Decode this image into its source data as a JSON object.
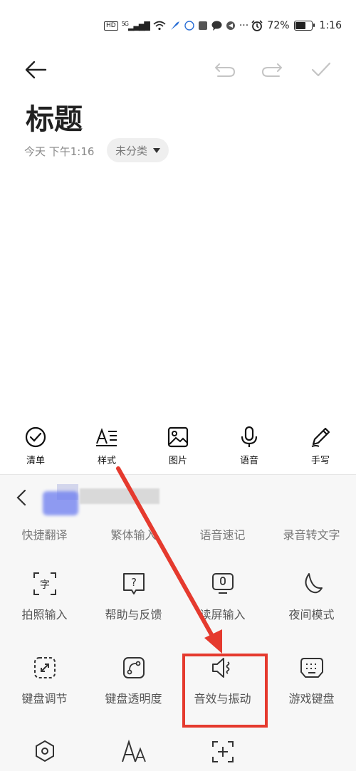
{
  "status_bar": {
    "hd": "HD",
    "signal": "5G",
    "battery_pct": "72%",
    "time": "1:16",
    "battery_level": 0.72,
    "icons": [
      "signal-icon",
      "wifi-icon",
      "app-icon",
      "chat-icon",
      "more-dots-icon",
      "alarm-icon",
      "battery-icon"
    ]
  },
  "note": {
    "title": "标题",
    "date": "今天  下午1:16",
    "category": "未分类"
  },
  "toolbar": {
    "items": [
      {
        "label": "清单",
        "icon": "checklist-icon"
      },
      {
        "label": "样式",
        "icon": "text-style-icon"
      },
      {
        "label": "图片",
        "icon": "image-icon"
      },
      {
        "label": "语音",
        "icon": "microphone-icon"
      },
      {
        "label": "手写",
        "icon": "pen-icon"
      }
    ]
  },
  "keyboard": {
    "top_row": [
      "快捷翻译",
      "繁体输入",
      "语音速记",
      "录音转文字"
    ],
    "row1": [
      {
        "label": "拍照输入",
        "icon": "camera-text-icon"
      },
      {
        "label": "帮助与反馈",
        "icon": "help-icon"
      },
      {
        "label": "读屏输入",
        "icon": "screen-input-icon"
      },
      {
        "label": "夜间模式",
        "icon": "moon-icon"
      }
    ],
    "row2": [
      {
        "label": "键盘调节",
        "icon": "resize-icon"
      },
      {
        "label": "键盘透明度",
        "icon": "transparency-icon"
      },
      {
        "label": "音效与振动",
        "icon": "sound-vibration-icon"
      },
      {
        "label": "游戏键盘",
        "icon": "game-keyboard-icon"
      }
    ],
    "row3_icons": [
      "settings-touch-icon",
      "font-size-icon",
      "add-icon"
    ]
  },
  "annotation_color": "#e53a2e"
}
